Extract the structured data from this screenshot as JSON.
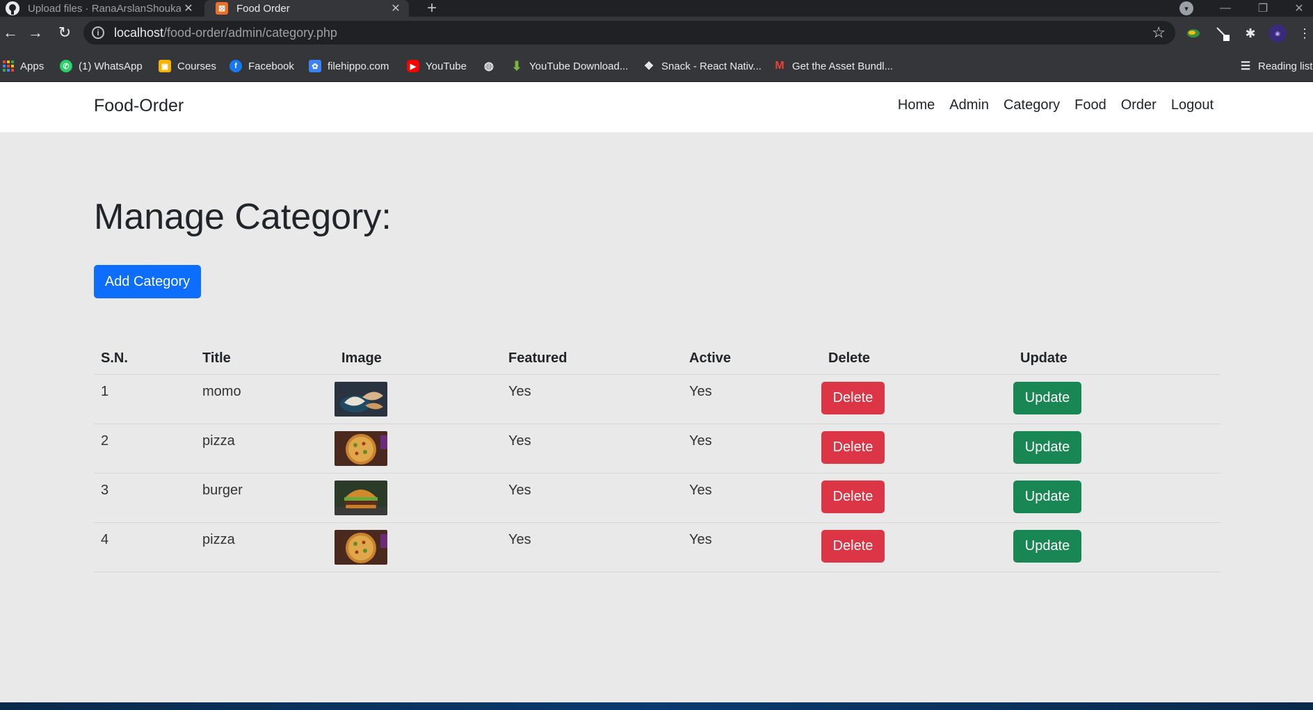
{
  "browser": {
    "tabs": [
      {
        "title": "Upload files · RanaArslanShoukat",
        "active": false,
        "favicon": "github-icon"
      },
      {
        "title": "Food Order",
        "active": true,
        "favicon": "xampp-icon"
      }
    ],
    "url_host": "localhost",
    "url_path": "/food-order/admin/category.php",
    "bookmarks": [
      {
        "label": "Apps",
        "icon": "apps-grid-icon"
      },
      {
        "label": "(1) WhatsApp",
        "icon": "whatsapp-icon",
        "color": "#25d366"
      },
      {
        "label": "Courses",
        "icon": "courses-icon",
        "color": "#f4b400"
      },
      {
        "label": "Facebook",
        "icon": "facebook-icon",
        "color": "#1877f2"
      },
      {
        "label": "filehippo.com",
        "icon": "filehippo-icon",
        "color": "#3b82f6"
      },
      {
        "label": "YouTube",
        "icon": "youtube-icon",
        "color": "#ff0000"
      },
      {
        "label": "",
        "icon": "globe-icon"
      },
      {
        "label": "YouTube Download...",
        "icon": "download-icon",
        "color": "#7cb342"
      },
      {
        "label": "Snack - React Nativ...",
        "icon": "snack-icon"
      },
      {
        "label": "Get the Asset Bundl...",
        "icon": "gmail-icon",
        "color": "#ea4335"
      }
    ],
    "reading_list": "Reading list"
  },
  "site": {
    "brand": "Food-Order",
    "nav": [
      "Home",
      "Admin",
      "Category",
      "Food",
      "Order",
      "Logout"
    ]
  },
  "page": {
    "title": "Manage Category:",
    "add_button": "Add Category"
  },
  "table": {
    "headers": [
      "S.N.",
      "Title",
      "Image",
      "Featured",
      "Active",
      "Delete",
      "Update"
    ],
    "rows": [
      {
        "sn": "1",
        "title": "momo",
        "image": "momo-thumbnail",
        "featured": "Yes",
        "active": "Yes",
        "delete": "Delete",
        "update": "Update"
      },
      {
        "sn": "2",
        "title": "pizza",
        "image": "pizza-thumbnail",
        "featured": "Yes",
        "active": "Yes",
        "delete": "Delete",
        "update": "Update"
      },
      {
        "sn": "3",
        "title": "burger",
        "image": "burger-thumbnail",
        "featured": "Yes",
        "active": "Yes",
        "delete": "Delete",
        "update": "Update"
      },
      {
        "sn": "4",
        "title": "pizza",
        "image": "pizza-thumbnail",
        "featured": "Yes",
        "active": "Yes",
        "delete": "Delete",
        "update": "Update"
      }
    ]
  },
  "colors": {
    "primary": "#0d6efd",
    "danger": "#dc3545",
    "success": "#198754",
    "page_bg": "#e9e9e9"
  }
}
